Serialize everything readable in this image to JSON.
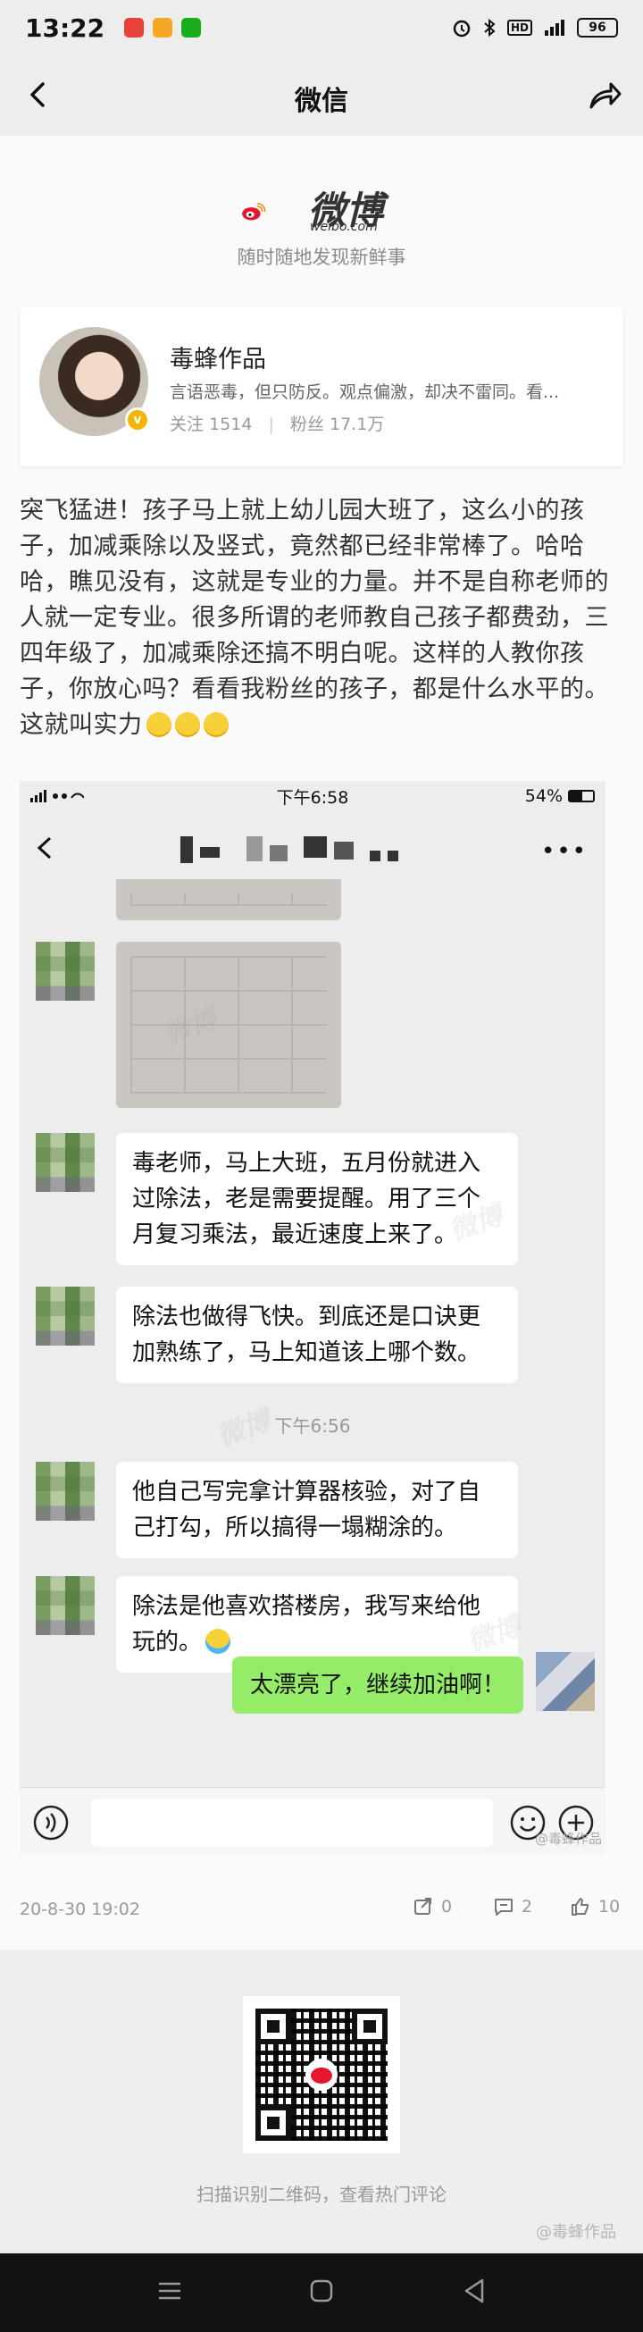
{
  "status_bar": {
    "time": "13:22",
    "app_colors": [
      "#e8413a",
      "#f5a623",
      "#1aad19"
    ],
    "battery": "96"
  },
  "navbar": {
    "title": "微信"
  },
  "weibo": {
    "logo_text": "微博",
    "logo_url": "weibo.com",
    "slogan": "随时随地发现新鲜事"
  },
  "author": {
    "name": "毒蜂作品",
    "bio": "言语恶毒，但只防反。观点偏激，却决不雷同。看...",
    "follow_label": "关注",
    "follow_count": "1514",
    "fans_label": "粉丝",
    "fans_count": "17.1万",
    "verified_badge": "v"
  },
  "post": {
    "text": "突飞猛进！孩子马上就上幼儿园大班了，这么小的孩子，加减乘除以及竖式，竟然都已经非常棒了。哈哈哈，瞧见没有，这就是专业的力量。并不是自称老师的人就一定专业。很多所谓的老师教自己孩子都费劲，三四年级了，加减乘除还搞不明白呢。这样的人教你孩子，你放心吗？看看我粉丝的孩子，都是什么水平的。这就叫实力",
    "date": "20-8-30 19:02",
    "repost_count": "0",
    "comment_count": "2",
    "like_count": "10"
  },
  "screenshot": {
    "status_time": "下午6:58",
    "battery": "54%",
    "messages": [
      {
        "type": "text",
        "text": "毒老师，马上大班，五月份就进入过除法，老是需要提醒。用了三个月复习乘法，最近速度上来了。"
      },
      {
        "type": "text",
        "text": "除法也做得飞快。到底还是口诀更加熟练了，马上知道该上哪个数。"
      },
      {
        "type": "time",
        "text": "下午6:56"
      },
      {
        "type": "text",
        "text": "他自己写完拿计算器核验，对了自己打勾，所以搞得一塌糊涂的。"
      },
      {
        "type": "text",
        "text": "除法是他喜欢搭楼房，我写来给他玩的。"
      },
      {
        "type": "me",
        "text": "太漂亮了，继续加油啊！"
      }
    ],
    "watermark": "微博",
    "corner_watermark": "@毒蜂作品"
  },
  "footer": {
    "qr_caption": "扫描识别二维码，查看热门评论",
    "watermark": "@毒蜂作品"
  }
}
